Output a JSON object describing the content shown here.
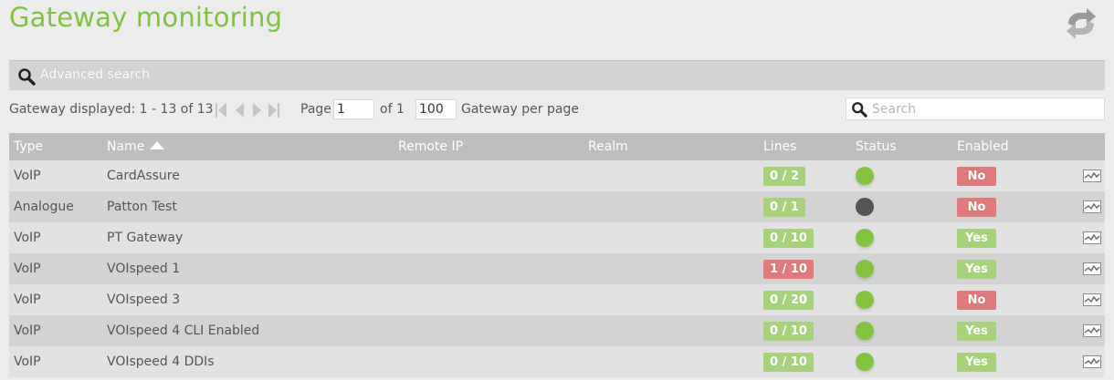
{
  "page": {
    "title": "Gateway monitoring"
  },
  "advanced_search": {
    "label": "Advanced search"
  },
  "pager": {
    "displayed": "Gateway displayed: 1 - 13 of 13",
    "page_label": "Page",
    "page_value": "1",
    "of_label": "of 1",
    "per_page_value": "100",
    "per_page_label": "Gateway per page"
  },
  "search": {
    "placeholder": "Search"
  },
  "table": {
    "headers": {
      "type": "Type",
      "name": "Name",
      "remote_ip": "Remote IP",
      "realm": "Realm",
      "lines": "Lines",
      "status": "Status",
      "enabled": "Enabled"
    },
    "rows": [
      {
        "type": "VoIP",
        "name": "CardAssure",
        "remote_ip": "",
        "realm": "",
        "lines": "0 / 2",
        "lines_state": "ok",
        "status": "online",
        "enabled": "No"
      },
      {
        "type": "Analogue",
        "name": "Patton Test",
        "remote_ip": "",
        "realm": "",
        "lines": "0 / 1",
        "lines_state": "ok",
        "status": "offline",
        "enabled": "No"
      },
      {
        "type": "VoIP",
        "name": "PT Gateway",
        "remote_ip": "",
        "realm": "",
        "lines": "0 / 10",
        "lines_state": "ok",
        "status": "online",
        "enabled": "Yes"
      },
      {
        "type": "VoIP",
        "name": "VOIspeed 1",
        "remote_ip": "",
        "realm": "",
        "lines": "1 / 10",
        "lines_state": "busy",
        "status": "online",
        "enabled": "Yes"
      },
      {
        "type": "VoIP",
        "name": "VOIspeed 3",
        "remote_ip": "",
        "realm": "",
        "lines": "0 / 20",
        "lines_state": "ok",
        "status": "online",
        "enabled": "No"
      },
      {
        "type": "VoIP",
        "name": "VOIspeed 4 CLI Enabled",
        "remote_ip": "",
        "realm": "",
        "lines": "0 / 10",
        "lines_state": "ok",
        "status": "online",
        "enabled": "Yes"
      },
      {
        "type": "VoIP",
        "name": "VOIspeed 4 DDIs",
        "remote_ip": "",
        "realm": "",
        "lines": "0 / 10",
        "lines_state": "ok",
        "status": "online",
        "enabled": "Yes"
      }
    ]
  },
  "colors": {
    "title_green": "#7fc241",
    "badge_green": "#a7d27c",
    "badge_red": "#de7a7a",
    "status_online": "#82c43f",
    "status_offline": "#555555",
    "header_bg": "#bdbdbd"
  },
  "icons": {
    "refresh": "refresh-icon",
    "search": "search-icon",
    "first": "first-page-icon",
    "prev": "prev-page-icon",
    "next": "next-page-icon",
    "last": "last-page-icon",
    "stats": "stats-chart-icon",
    "sort": "sort-ascending-icon"
  }
}
